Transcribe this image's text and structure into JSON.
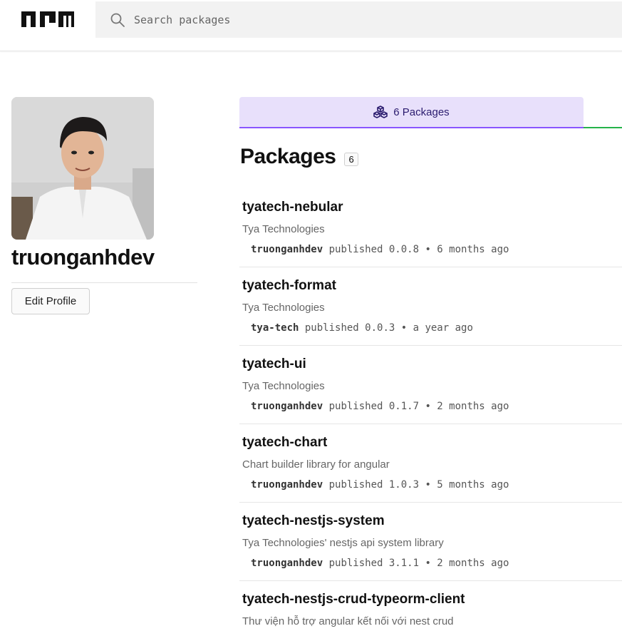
{
  "header": {
    "logo_alt": "npm",
    "search_placeholder": "Search packages"
  },
  "profile": {
    "username": "truonganhdev",
    "edit_button": "Edit Profile"
  },
  "tabs": [
    {
      "label": "6 Packages",
      "icon": "packages-icon",
      "active": true
    }
  ],
  "section": {
    "title": "Packages",
    "count": "6"
  },
  "packages": [
    {
      "name": "tyatech-nebular",
      "description": "Tya Technologies",
      "publisher": "truonganhdev",
      "published_text": "published 0.0.8 • 6 months ago"
    },
    {
      "name": "tyatech-format",
      "description": "Tya Technologies",
      "publisher": "tya-tech",
      "published_text": "published 0.0.3 • a year ago"
    },
    {
      "name": "tyatech-ui",
      "description": "Tya Technologies",
      "publisher": "truonganhdev",
      "published_text": "published 0.1.7 • 2 months ago"
    },
    {
      "name": "tyatech-chart",
      "description": "Chart builder library for angular",
      "publisher": "truonganhdev",
      "published_text": "published 1.0.3 • 5 months ago"
    },
    {
      "name": "tyatech-nestjs-system",
      "description": "Tya Technologies' nestjs api system library",
      "publisher": "truonganhdev",
      "published_text": "published 3.1.1 • 2 months ago"
    },
    {
      "name": "tyatech-nestjs-crud-typeorm-client",
      "description": "Thư viện hỗ trợ angular kết nối với nest crud",
      "publisher": "",
      "published_text": ""
    }
  ],
  "colors": {
    "tab_bg": "#e8e0fb",
    "tab_border": "#8956ff",
    "accent_green": "#25b34a"
  }
}
